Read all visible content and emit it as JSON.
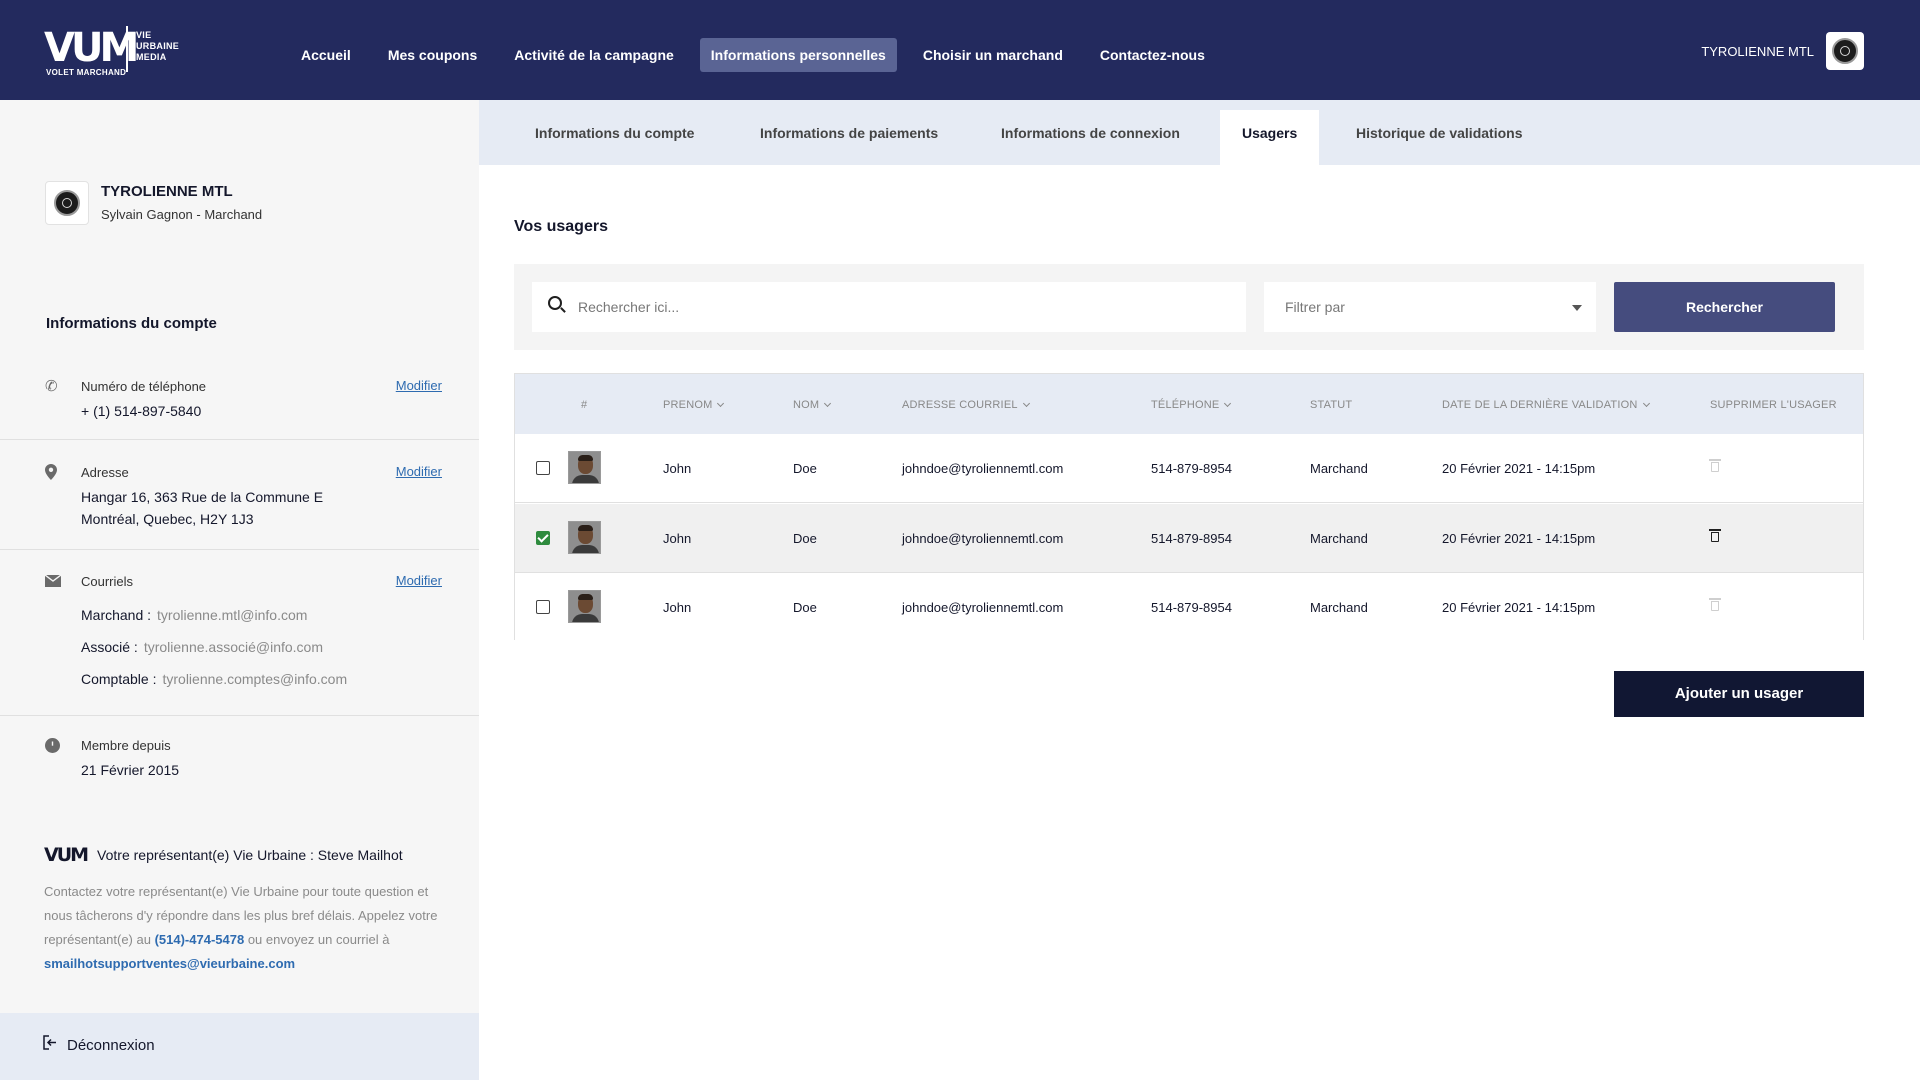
{
  "logo": {
    "mark": "VUM",
    "line1": "VIE",
    "line2": "URBAINE",
    "line3": "MEDIA",
    "subtitle": "VOLET MARCHAND"
  },
  "nav": [
    {
      "label": "Accueil",
      "active": false
    },
    {
      "label": "Mes coupons",
      "active": false
    },
    {
      "label": "Activité de la campagne",
      "active": false
    },
    {
      "label": "Informations personnelles",
      "active": true
    },
    {
      "label": "Choisir un marchand",
      "active": false
    },
    {
      "label": "Contactez-nous",
      "active": false
    }
  ],
  "user": {
    "name": "TYROLIENNE MTL"
  },
  "profile": {
    "name": "TYROLIENNE MTL",
    "role": "Sylvain Gagnon - Marchand"
  },
  "sidebar": {
    "heading": "Informations du compte",
    "modify_label": "Modifier",
    "phone": {
      "label": "Numéro de téléphone",
      "value": "+ (1) 514-897-5840"
    },
    "address": {
      "label": "Adresse",
      "line1": "Hangar 16, 363 Rue de la Commune E",
      "line2": "Montréal, Quebec, H2Y 1J3"
    },
    "emails": {
      "label": "Courriels",
      "items": [
        {
          "role": "Marchand :",
          "value": "tyrolienne.mtl@info.com"
        },
        {
          "role": "Associé :",
          "value": "tyrolienne.associé@info.com"
        },
        {
          "role": "Comptable :",
          "value": "tyrolienne.comptes@info.com"
        }
      ]
    },
    "member": {
      "label": "Membre depuis",
      "value": "21 Février 2015"
    },
    "rep": {
      "mark": "VUM",
      "title": "Votre représentant(e) Vie Urbaine : Steve Mailhot",
      "text1": "Contactez votre représentant(e) Vie Urbaine pour toute question et nous tâcherons d'y répondre dans les plus bref délais. Appelez votre représentant(e) au",
      "phone": "(514)-474-5478",
      "text2": "ou envoyez un courriel à",
      "email": "smailhotsupportventes@vieurbaine.com"
    },
    "logout": "Déconnexion"
  },
  "tabs": [
    {
      "label": "Informations du compte",
      "active": false
    },
    {
      "label": "Informations de paiements",
      "active": false
    },
    {
      "label": "Informations de connexion",
      "active": false
    },
    {
      "label": "Usagers",
      "active": true
    },
    {
      "label": "Historique de validations",
      "active": false
    }
  ],
  "section_title": "Vos usagers",
  "search": {
    "placeholder": "Rechercher ici...",
    "filter_label": "Filtrer par",
    "button": "Rechercher"
  },
  "table": {
    "columns": [
      "#",
      "PRENOM",
      "NOM",
      "ADRESSE COURRIEL",
      "TÉLÉPHONE",
      "STATUT",
      "DATE DE LA DERNIÈRE VALIDATION",
      "SUPPRIMER L'USAGER"
    ],
    "rows": [
      {
        "first": "John",
        "last": "Doe",
        "email": "johndoe@tyroliennemtl.com",
        "phone": "514-879-8954",
        "status": "Marchand",
        "date": "20 Février 2021 - 14:15pm",
        "checked": false
      },
      {
        "first": "John",
        "last": "Doe",
        "email": "johndoe@tyroliennemtl.com",
        "phone": "514-879-8954",
        "status": "Marchand",
        "date": "20 Février 2021 - 14:15pm",
        "checked": true
      },
      {
        "first": "John",
        "last": "Doe",
        "email": "johndoe@tyroliennemtl.com",
        "phone": "514-879-8954",
        "status": "Marchand",
        "date": "20 Février 2021 - 14:15pm",
        "checked": false
      }
    ]
  },
  "add_button": "Ajouter un usager",
  "colors": {
    "navy": "#232a5e",
    "active_nav": "#5a6494",
    "search_button": "#454c7e",
    "add_button": "#111733",
    "link": "#2e6bb0",
    "checkbox_checked": "#2e8b3e"
  }
}
